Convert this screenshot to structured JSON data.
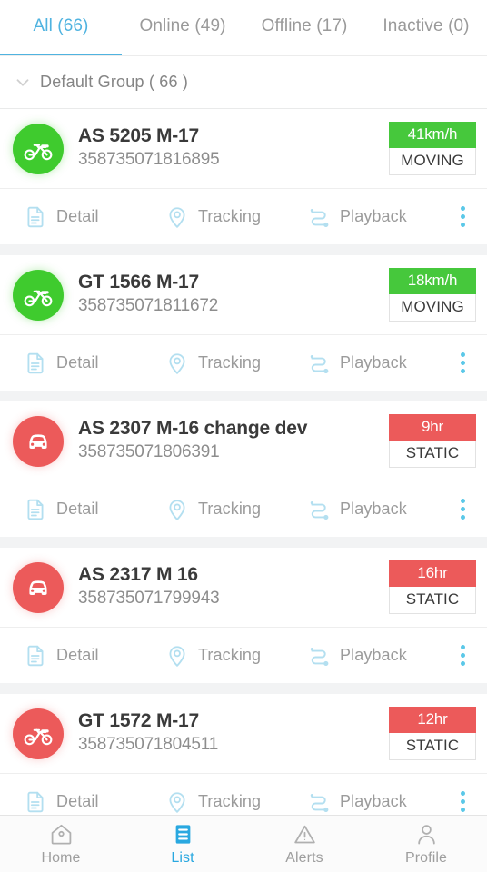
{
  "tabs": [
    {
      "label": "All (66)",
      "active": true
    },
    {
      "label": "Online (49)",
      "active": false
    },
    {
      "label": "Offline (17)",
      "active": false
    },
    {
      "label": "Inactive (0)",
      "active": false
    }
  ],
  "group": {
    "label": "Default Group ( 66 )",
    "chevron_icon": "chevron-down-icon"
  },
  "actions": {
    "detail": "Detail",
    "tracking": "Tracking",
    "playback": "Playback",
    "detail_icon": "document-icon",
    "tracking_icon": "map-pin-icon",
    "playback_icon": "route-icon",
    "more_icon": "kebab-menu-icon"
  },
  "vehicles": [
    {
      "name": "AS 5205 M-17",
      "imei": "358735071816895",
      "badge_value": "41km/h",
      "status": "MOVING",
      "state": "moving",
      "vehicle_icon": "motorcycle-icon"
    },
    {
      "name": "GT 1566 M-17",
      "imei": "358735071811672",
      "badge_value": "18km/h",
      "status": "MOVING",
      "state": "moving",
      "vehicle_icon": "motorcycle-icon"
    },
    {
      "name": "AS 2307 M-16 change dev",
      "imei": "358735071806391",
      "badge_value": "9hr",
      "status": "STATIC",
      "state": "static",
      "vehicle_icon": "car-icon"
    },
    {
      "name": "AS 2317 M 16",
      "imei": "358735071799943",
      "badge_value": "16hr",
      "status": "STATIC",
      "state": "static",
      "vehicle_icon": "car-icon"
    },
    {
      "name": "GT 1572 M-17",
      "imei": "358735071804511",
      "badge_value": "12hr",
      "status": "STATIC",
      "state": "static",
      "vehicle_icon": "motorcycle-icon"
    }
  ],
  "bottom_nav": [
    {
      "label": "Home",
      "icon": "home-icon",
      "active": false
    },
    {
      "label": "List",
      "icon": "list-icon",
      "active": true
    },
    {
      "label": "Alerts",
      "icon": "alert-triangle-icon",
      "active": false
    },
    {
      "label": "Profile",
      "icon": "person-icon",
      "active": false
    }
  ],
  "colors": {
    "accent": "#4fb3e0",
    "moving": "#46c83c",
    "static": "#ec5a5a",
    "nav_active": "#29a8e0",
    "icon_tint": "#b8e0ef"
  }
}
